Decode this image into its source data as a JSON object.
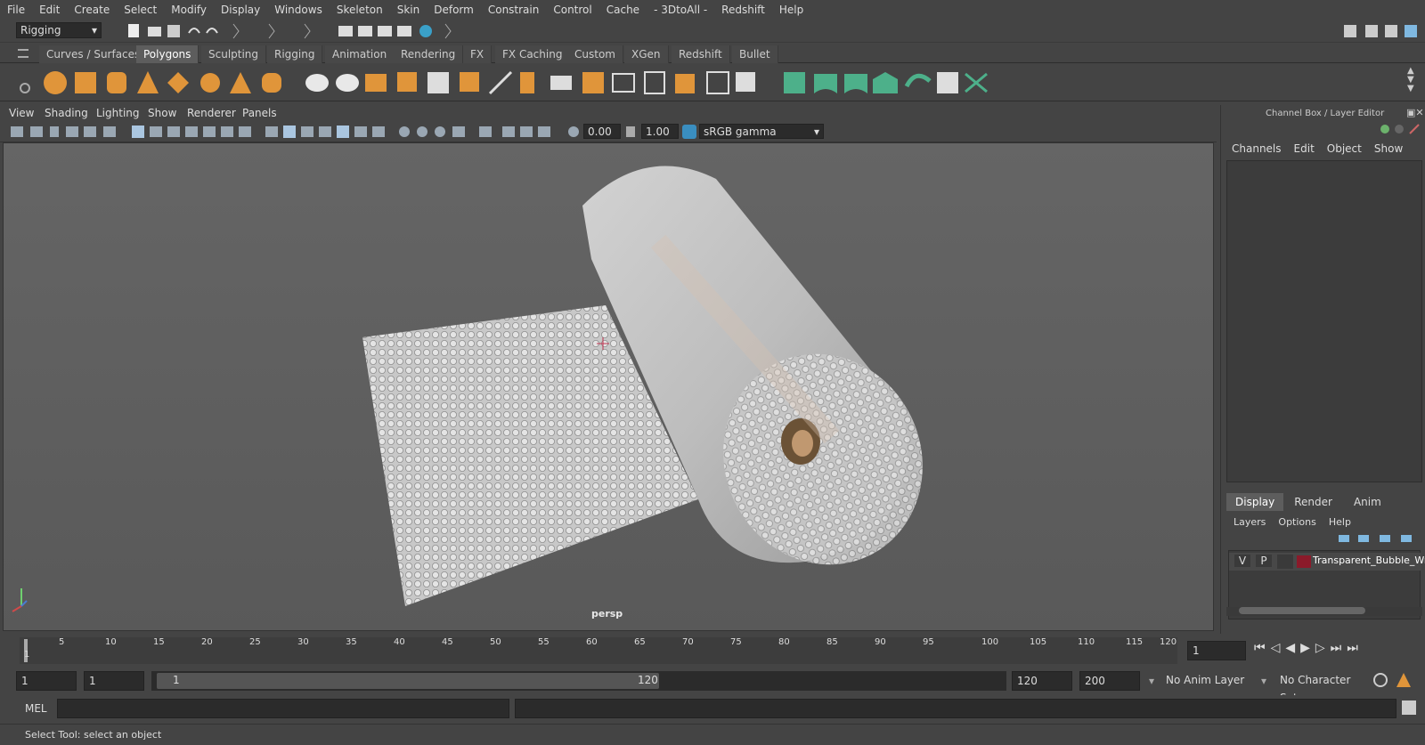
{
  "menu": [
    "File",
    "Edit",
    "Create",
    "Select",
    "Modify",
    "Display",
    "Windows",
    "Skeleton",
    "Skin",
    "Deform",
    "Constrain",
    "Control",
    "Cache",
    "- 3DtoAll -",
    "Redshift",
    "Help"
  ],
  "status": {
    "mode": "Rigging"
  },
  "shelf_tabs": [
    "Curves / Surfaces",
    "Polygons",
    "Sculpting",
    "Rigging",
    "Animation",
    "Rendering",
    "FX",
    "FX Caching",
    "Custom",
    "XGen",
    "Redshift",
    "Bullet"
  ],
  "shelf_selected": "Polygons",
  "viewport": {
    "menus": [
      "View",
      "Shading",
      "Lighting",
      "Show",
      "Renderer",
      "Panels"
    ],
    "exposure": "0.00",
    "gamma": "1.00",
    "colorspace": "sRGB gamma",
    "camera": "persp"
  },
  "channel_box": {
    "title": "Channel Box / Layer Editor",
    "menus": [
      "Channels",
      "Edit",
      "Object",
      "Show"
    ]
  },
  "layer_editor": {
    "tabs": [
      "Display",
      "Render",
      "Anim"
    ],
    "menus": [
      "Layers",
      "Options",
      "Help"
    ],
    "layer": {
      "v": "V",
      "p": "P",
      "name": "Transparent_Bubble_Wra"
    }
  },
  "timeline": {
    "ticks": [
      "1",
      "5",
      "10",
      "15",
      "20",
      "25",
      "30",
      "35",
      "40",
      "45",
      "50",
      "55",
      "60",
      "65",
      "70",
      "75",
      "80",
      "85",
      "90",
      "95",
      "100",
      "105",
      "110",
      "115",
      "120"
    ],
    "current": "1"
  },
  "range": {
    "start": "1",
    "start2": "1",
    "slider_start": "1",
    "slider_end": "120",
    "end": "120",
    "end2": "200",
    "anim_layer": "No Anim Layer",
    "char_set": "No Character Set"
  },
  "cmd": {
    "label": "MEL"
  },
  "help": {
    "text": "Select Tool: select an object"
  },
  "colors": {
    "layer": "#8b1a2a",
    "accent": "#5d5d5d",
    "shelf_orange": "#e0953a",
    "shelf_green": "#4db08a"
  }
}
